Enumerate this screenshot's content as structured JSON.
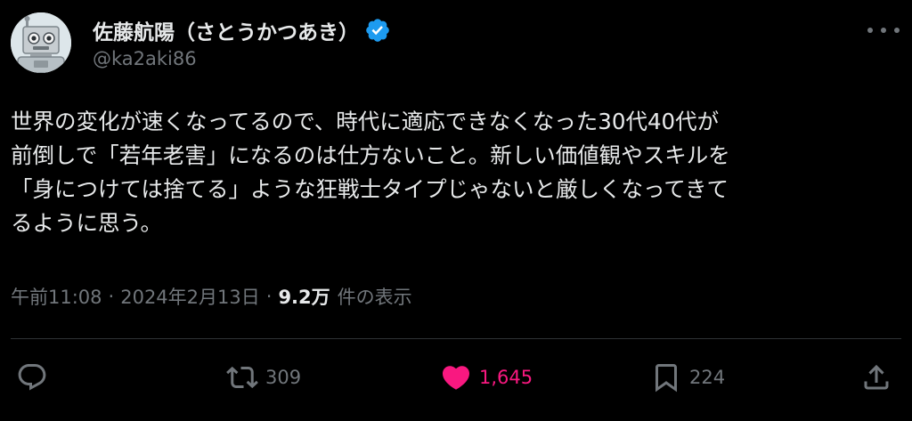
{
  "author": {
    "display_name": "佐藤航陽（さとうかつあき）",
    "handle": "@ka2aki86",
    "verified": true,
    "avatar_icon": "robot-avatar",
    "verified_icon": "verified-badge-icon",
    "verified_color": "#1d9bf0"
  },
  "tweet": {
    "lines": [
      "世界の変化が速くなってるので、時代に適応できなくなった30代40代が",
      "前倒しで「若年老害」になるのは仕方ないこと。新しい価値観やスキルを",
      "「身につけては捨てる」ような狂戦士タイプじゃないと厳しくなってきて",
      "るように思う。"
    ]
  },
  "meta": {
    "time": "午前11:08",
    "separator": "·",
    "date": "2024年2月13日",
    "views_count": "9.2万",
    "views_label": "件の表示"
  },
  "actions": {
    "reply": {
      "icon": "reply-icon",
      "count": ""
    },
    "retweet": {
      "icon": "retweet-icon",
      "count": "309"
    },
    "like": {
      "icon": "heart-icon",
      "count": "1,645",
      "active": true,
      "color": "#f91880"
    },
    "bookmark": {
      "icon": "bookmark-icon",
      "count": "224"
    },
    "share": {
      "icon": "share-icon",
      "count": ""
    }
  },
  "colors": {
    "background": "#000000",
    "text_primary": "#e7e9ea",
    "text_secondary": "#71767b",
    "divider": "#2f3336"
  }
}
